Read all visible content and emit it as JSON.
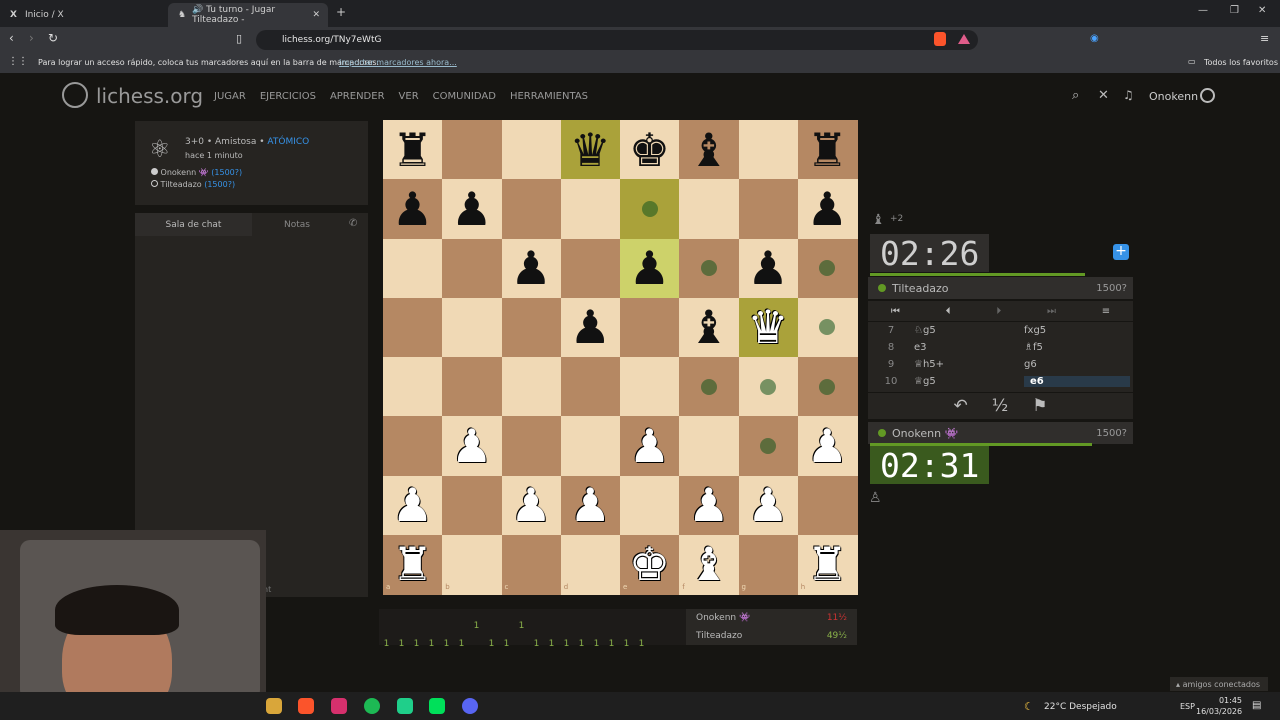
{
  "browser": {
    "tabs": [
      {
        "label": "Inicio / X"
      },
      {
        "label": "🔊 Tu turno - Jugar Tilteadazo -"
      }
    ],
    "url": "lichess.org/TNy7eWtG",
    "bookmarks_msg": "Para lograr un acceso rápido, coloca tus marcadores aquí en la barra de marcadores.",
    "bookmarks_link": "Importar marcadores ahora...",
    "all_favs": "Todos los favoritos"
  },
  "site": {
    "logo": "lichess.org",
    "nav": [
      "JUGAR",
      "EJERCICIOS",
      "APRENDER",
      "VER",
      "COMUNIDAD",
      "HERRAMIENTAS"
    ],
    "user": "Onokenn"
  },
  "game": {
    "mode": "3+0 • Amistosa • ",
    "variant": "ATÓMICO",
    "time_ago": "hace 1 minuto",
    "white_player": "Onokenn 👾 ",
    "white_rating": "(1500?)",
    "black_player": "Tilteadazo ",
    "black_rating": "(1500?)"
  },
  "chat": {
    "tab_chat": "Sala de chat",
    "tab_notes": "Notas",
    "bottom": "nt"
  },
  "board": {
    "files": [
      "a",
      "b",
      "c",
      "d",
      "e",
      "f",
      "g",
      "h"
    ],
    "ranks": [
      "8",
      "7",
      "6",
      "5",
      "4",
      "3",
      "2",
      "1"
    ],
    "pieces": [
      {
        "sq": "a8",
        "g": "♜"
      },
      {
        "sq": "d8",
        "g": "♛"
      },
      {
        "sq": "e8",
        "g": "♚"
      },
      {
        "sq": "f8",
        "g": "♝"
      },
      {
        "sq": "h8",
        "g": "♜"
      },
      {
        "sq": "a7",
        "g": "♟"
      },
      {
        "sq": "b7",
        "g": "♟"
      },
      {
        "sq": "h7",
        "g": "♟"
      },
      {
        "sq": "c6",
        "g": "♟"
      },
      {
        "sq": "e6",
        "g": "♟"
      },
      {
        "sq": "g6",
        "g": "♟"
      },
      {
        "sq": "d5",
        "g": "♟"
      },
      {
        "sq": "f5",
        "g": "♝"
      },
      {
        "sq": "g5",
        "g": "♕"
      },
      {
        "sq": "b3",
        "g": "♙"
      },
      {
        "sq": "e3",
        "g": "♙"
      },
      {
        "sq": "h3",
        "g": "♙"
      },
      {
        "sq": "a2",
        "g": "♙"
      },
      {
        "sq": "c2",
        "g": "♙"
      },
      {
        "sq": "d2",
        "g": "♙"
      },
      {
        "sq": "f2",
        "g": "♙"
      },
      {
        "sq": "g2",
        "g": "♙"
      },
      {
        "sq": "a1",
        "g": "♖"
      },
      {
        "sq": "e1",
        "g": "♔"
      },
      {
        "sq": "f1",
        "g": "♗"
      },
      {
        "sq": "h1",
        "g": "♖"
      }
    ],
    "highlights": [
      "d8",
      "e7",
      "e6",
      "g5"
    ],
    "dots": [
      "e7",
      "f6",
      "h6",
      "h5",
      "f4",
      "g4",
      "h4",
      "g3"
    ]
  },
  "right": {
    "black_material": "+2",
    "black_clock": "02:26",
    "black_name": "Tilteadazo",
    "black_rating": "1500?",
    "moves": [
      {
        "n": "7",
        "w": "♘g5",
        "b": "fxg5"
      },
      {
        "n": "8",
        "w": "e3",
        "b": "♗f5"
      },
      {
        "n": "9",
        "w": "♕h5+",
        "b": "g6"
      },
      {
        "n": "10",
        "w": "♕g5",
        "b": "e6"
      }
    ],
    "draw": "½",
    "white_name": "Onokenn 👾",
    "white_rating": "1500?",
    "white_clock": "02:31"
  },
  "crosstable": {
    "row1": [
      "",
      "",
      "",
      "",
      "",
      "",
      "1",
      "",
      "",
      "1",
      "",
      "",
      "",
      "",
      "",
      "",
      "",
      ""
    ],
    "row2": [
      "1",
      "1",
      "1",
      "1",
      "1",
      "1",
      "",
      "1",
      "1",
      "",
      "1",
      "1",
      "1",
      "1",
      "1",
      "1",
      "1",
      "1"
    ],
    "p1": "Onokenn 👾",
    "s1": "11½",
    "p2": "Tilteadazo",
    "s2": "49½"
  },
  "taskbar": {
    "weather": "22°C  Despejado",
    "lang": "ESP",
    "time": "01:45",
    "date": "16/03/2026",
    "friends": "amigos conectados"
  },
  "colors": {
    "light": "#f0d9b5",
    "dark": "#b58863",
    "accent": "#629924",
    "link": "#3692e7"
  }
}
